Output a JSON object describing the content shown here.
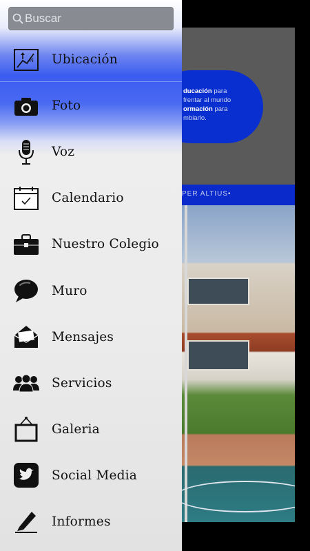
{
  "search": {
    "placeholder": "Buscar"
  },
  "menu": [
    {
      "label": "Ubicación",
      "icon": "map-location-icon"
    },
    {
      "label": "Foto",
      "icon": "camera-icon"
    },
    {
      "label": "Voz",
      "icon": "microphone-icon"
    },
    {
      "label": "Calendario",
      "icon": "calendar-icon"
    },
    {
      "label": "Nuestro Colegio",
      "icon": "briefcase-icon"
    },
    {
      "label": "Muro",
      "icon": "speech-bubble-icon"
    },
    {
      "label": "Mensajes",
      "icon": "envelope-icon"
    },
    {
      "label": "Servicios",
      "icon": "people-group-icon"
    },
    {
      "label": "Galeria",
      "icon": "picture-frame-icon"
    },
    {
      "label": "Social Media",
      "icon": "twitter-bird-icon"
    },
    {
      "label": "Informes",
      "icon": "pencil-icon"
    }
  ],
  "background": {
    "pill_text": {
      "line1_bold": "ducación",
      "line1": " para",
      "line2": "frentar al mundo",
      "line3_bold": "ormación",
      "line3": " para",
      "line4": "mbiarlo."
    },
    "band_text": "PER ALTIUS•"
  },
  "colors": {
    "accent": "#3a5cf0",
    "pill": "#0a2fd0",
    "band": "#0a2acb"
  }
}
